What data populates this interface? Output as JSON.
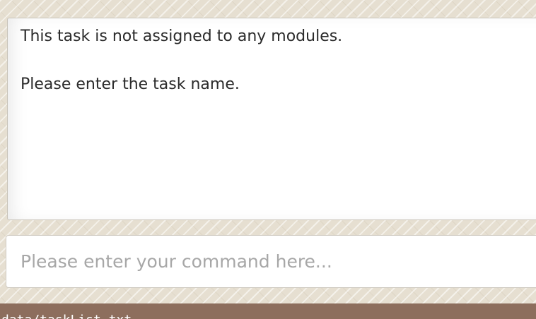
{
  "output": {
    "lines": [
      "This task is not assigned to any modules.",
      "Please enter the task name."
    ]
  },
  "command": {
    "value": "",
    "placeholder": "Please enter your command here..."
  },
  "status_bar": {
    "text": "data/taskList.txt"
  },
  "colors": {
    "background": "#e6dfd1",
    "panel": "#ffffff",
    "status_bar": "#8d6e5d",
    "placeholder": "#a7a7a7",
    "text": "#2b2b2b"
  }
}
